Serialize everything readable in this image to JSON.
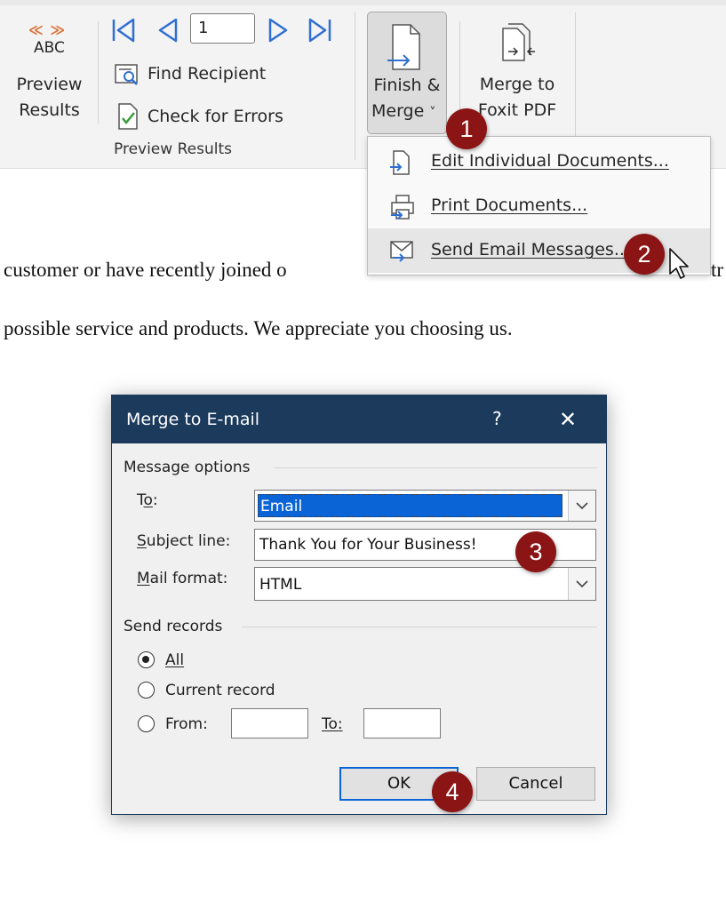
{
  "ribbon": {
    "preview_results_btn": {
      "icon_text": "ABC",
      "label_line1": "Preview",
      "label_line2": "Results"
    },
    "record_number": "1",
    "find_recipient": "Find Recipient",
    "check_errors": "Check for Errors",
    "group_label": "Preview Results",
    "finish_merge": {
      "line1": "Finish &",
      "line2": "Merge",
      "arrow": "˅"
    },
    "merge_foxit": {
      "line1": "Merge to",
      "line2": "Foxit PDF"
    }
  },
  "menu": {
    "items": [
      {
        "label": "Edit Individual Documents..."
      },
      {
        "label": "Print Documents..."
      },
      {
        "label": "Send Email Messages..."
      }
    ]
  },
  "document": {
    "line1": "customer or have recently joined o",
    "line1_tail": "tr",
    "line2": "possible service and products. We appreciate you choosing us."
  },
  "badges": [
    "1",
    "2",
    "3",
    "4"
  ],
  "dialog": {
    "title": "Merge to E-mail",
    "help": "?",
    "close": "✕",
    "message_options": "Message options",
    "to_label": "To:",
    "to_value": "Email",
    "subject_label": "Subject line:",
    "subject_value": "Thank You for Your Business!",
    "format_label": "Mail format:",
    "format_value": "HTML",
    "send_records": "Send records",
    "all": "All",
    "current": "Current record",
    "from": "From:",
    "to2": "To:",
    "ok": "OK",
    "cancel": "Cancel"
  },
  "colors": {
    "titlebar": "#1b3a5c",
    "badge": "#8b1414",
    "selection": "#0a64d6",
    "accent_blue": "#2f6fd1"
  }
}
